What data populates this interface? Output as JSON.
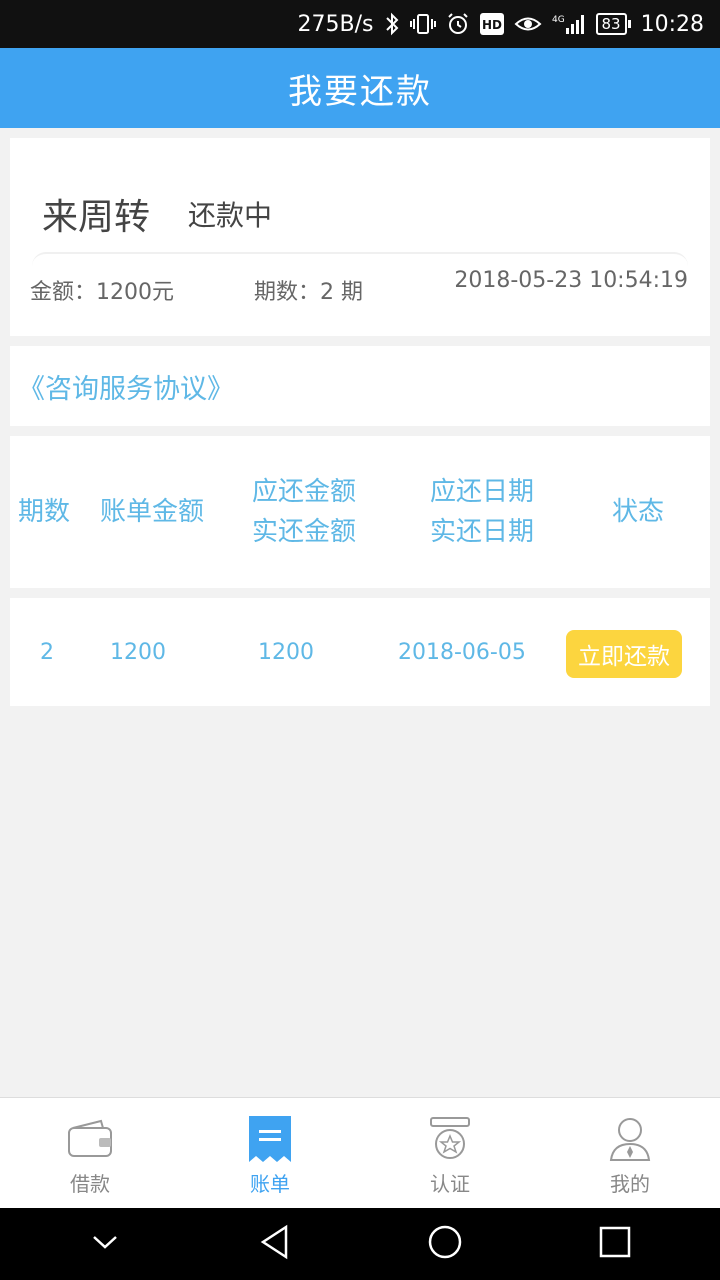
{
  "status_bar": {
    "net_speed": "275B/s",
    "battery": "83",
    "time": "10:28",
    "icons": [
      "bluetooth-icon",
      "vibrate-icon",
      "alarm-icon",
      "hd-icon",
      "eye-icon",
      "signal-4g-icon",
      "battery-icon"
    ]
  },
  "header": {
    "title": "我要还款"
  },
  "loan": {
    "name": "来周转",
    "status": "还款中",
    "amount": "金额：1200元",
    "periods": "期数：2 期",
    "datetime": "2018-05-23 10:54:19"
  },
  "agreement": {
    "link": "《咨询服务协议》"
  },
  "table": {
    "headers": {
      "period": "期数",
      "bill_amount": "账单金额",
      "due_amount": "应还金额",
      "paid_amount": "实还金额",
      "due_date": "应还日期",
      "paid_date": "实还日期",
      "status": "状态"
    },
    "rows": [
      {
        "period": "2",
        "bill_amount": "1200",
        "due_amount": "1200",
        "due_date": "2018-06-05",
        "action": "立即还款"
      }
    ]
  },
  "tabs": [
    {
      "label": "借款",
      "icon": "wallet-icon"
    },
    {
      "label": "账单",
      "icon": "bill-icon",
      "active": true
    },
    {
      "label": "认证",
      "icon": "badge-icon"
    },
    {
      "label": "我的",
      "icon": "user-icon"
    }
  ],
  "colors": {
    "primary": "#3fa3f1",
    "accent_text": "#5fb8e6",
    "pay_button": "#fcd53f",
    "background": "#f2f2f2"
  }
}
